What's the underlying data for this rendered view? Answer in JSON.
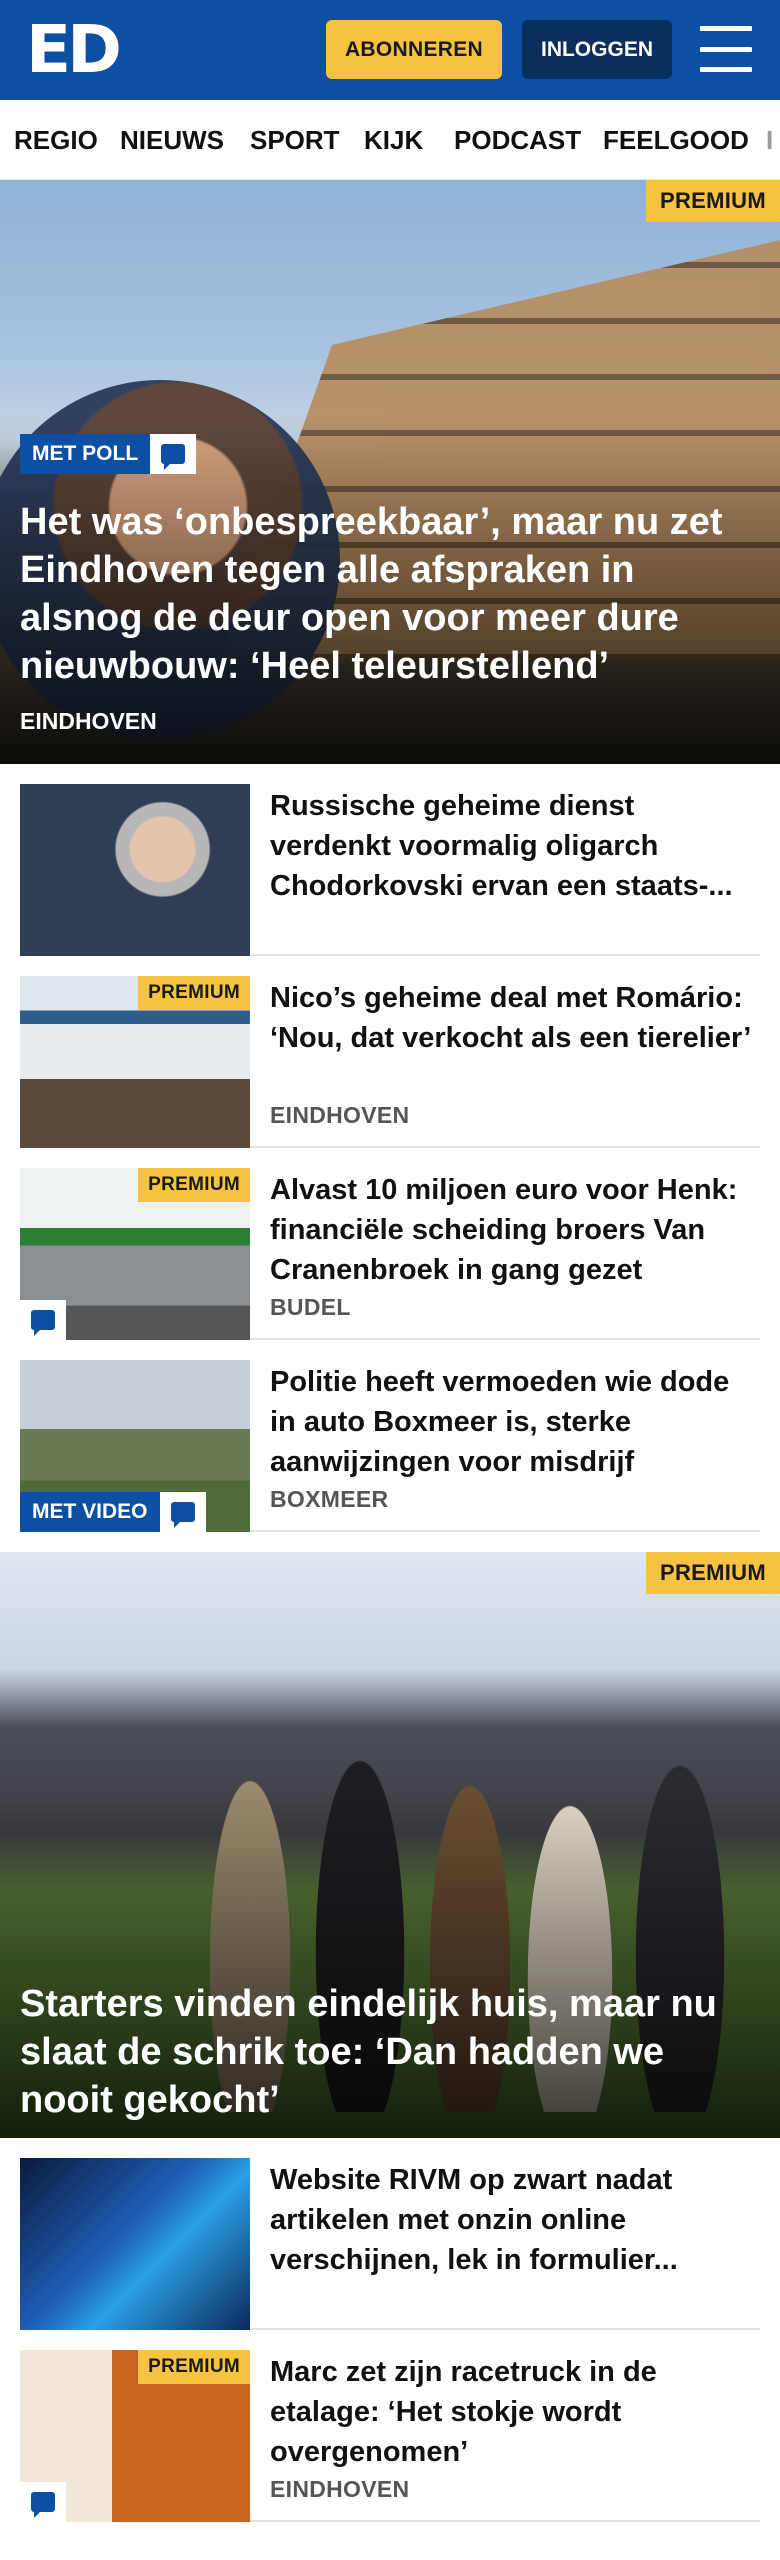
{
  "header": {
    "logo_text": "ED",
    "subscribe_label": "ABONNEREN",
    "login_label": "INLOGGEN",
    "accent_color": "#0d4fa3",
    "subscribe_color": "#f5c242"
  },
  "nav": {
    "items": [
      "REGIO",
      "NIEUWS",
      "SPORT",
      "KIJK",
      "PODCAST",
      "FEELGOOD",
      "I"
    ]
  },
  "hero1": {
    "premium": "PREMIUM",
    "badge": "MET POLL",
    "title": "Het was ‘onbespreekbaar’, maar nu zet Eindhoven tegen alle afspraken in alsnog de deur open voor meer dure nieuwbouw: ‘Heel teleurstellend’",
    "location": "EINDHOVEN"
  },
  "list1": [
    {
      "title": "Russische geheime dienst verdenkt voormalig oligarch Chodorkovski ervan een staats-...",
      "location": "",
      "premium": ""
    },
    {
      "title": "Nico’s geheime deal met Romário: ‘Nou, dat verkocht als een tierelier’",
      "location": "EINDHOVEN",
      "premium": "PREMIUM"
    },
    {
      "title": "Alvast 10 miljoen euro voor Henk: financiële scheiding broers Van Cranenbroek in gang gezet",
      "location": "BUDEL",
      "premium": "PREMIUM"
    },
    {
      "title": "Politie heeft vermoeden wie dode in auto Boxmeer is, sterke aanwijzingen voor misdrijf",
      "location": "BOXMEER",
      "premium": "",
      "badge": "MET VIDEO"
    }
  ],
  "hero2": {
    "premium": "PREMIUM",
    "title": "Starters vinden eindelijk huis, maar nu slaat de schrik toe: ‘Dan hadden we nooit gekocht’"
  },
  "list2": [
    {
      "title": "Website RIVM op zwart nadat artikelen met onzin online verschijnen, lek in formulier...",
      "location": "",
      "premium": ""
    },
    {
      "title": "Marc zet zijn racetruck in de etalage: ‘Het stokje wordt overgenomen’",
      "location": "EINDHOVEN",
      "premium": "PREMIUM"
    }
  ]
}
